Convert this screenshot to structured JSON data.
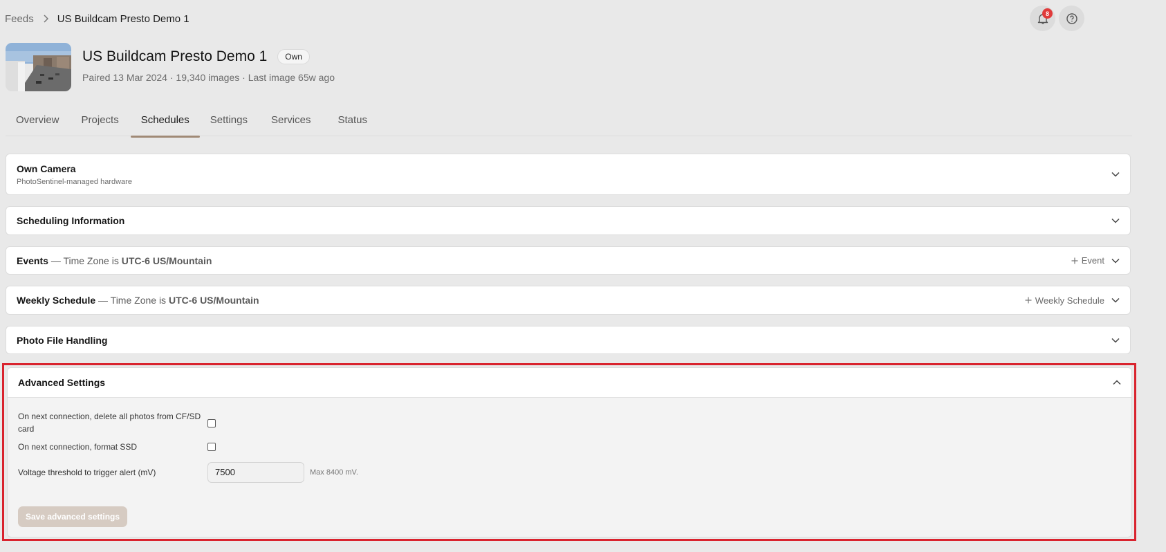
{
  "breadcrumb": {
    "parent": "Feeds",
    "current": "US Buildcam Presto Demo 1"
  },
  "notifications": {
    "count": "8"
  },
  "feed": {
    "title": "US Buildcam Presto Demo 1",
    "badge": "Own",
    "meta": "Paired 13 Mar 2024 · 19,340 images · Last image 65w ago"
  },
  "tabs": [
    {
      "label": "Overview"
    },
    {
      "label": "Projects"
    },
    {
      "label": "Schedules"
    },
    {
      "label": "Settings"
    },
    {
      "label": "Services"
    },
    {
      "label": "Status"
    }
  ],
  "sections": {
    "own_camera": {
      "title": "Own Camera",
      "subtitle": "PhotoSentinel-managed hardware"
    },
    "scheduling": {
      "title": "Scheduling Information"
    },
    "events": {
      "title": "Events",
      "tz_prefix": "— Time Zone is",
      "tz": "UTC-6 US/Mountain",
      "action": "Event"
    },
    "weekly": {
      "title": "Weekly Schedule",
      "tz_prefix": "— Time Zone is",
      "tz": "UTC-6 US/Mountain",
      "action": "Weekly Schedule"
    },
    "photo_file": {
      "title": "Photo File Handling"
    },
    "advanced": {
      "title": "Advanced Settings",
      "delete_label": "On next connection, delete all photos from CF/SD card",
      "format_label": "On next connection, format SSD",
      "voltage_label": "Voltage threshold to trigger alert (mV)",
      "voltage_value": "7500",
      "voltage_hint": "Max 8400 mV.",
      "save_label": "Save advanced settings"
    }
  },
  "colors": {
    "accent": "#a08a76",
    "highlight": "#d9232e",
    "badge": "#e03b3b"
  }
}
